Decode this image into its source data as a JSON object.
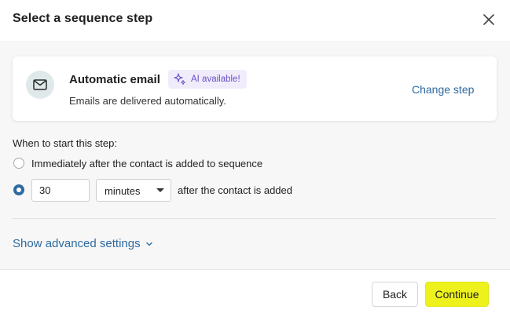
{
  "dialog": {
    "title": "Select a sequence step",
    "close_icon": "close-icon"
  },
  "step": {
    "icon": "mail-icon",
    "name": "Automatic email",
    "ai_badge": {
      "icon": "sparkle-icon",
      "label": "AI available!"
    },
    "description": "Emails are delivered automatically.",
    "change_label": "Change step"
  },
  "timing": {
    "label": "When to start this step:",
    "options": [
      {
        "label": "Immediately after the contact is added to sequence",
        "selected": false
      },
      {
        "selected": true,
        "delay_value": "30",
        "unit": "minutes",
        "suffix": "after the contact is added"
      }
    ]
  },
  "advanced": {
    "label": "Show advanced settings",
    "icon": "chevron-down-icon"
  },
  "footer": {
    "back_label": "Back",
    "continue_label": "Continue"
  },
  "colors": {
    "link": "#2d6aa0",
    "primary_button": "#eef21c",
    "ai_badge_bg": "#f1ecfb",
    "ai_badge_text": "#6b4fc9",
    "radio_selected": "#2d6aa0",
    "body_background": "#f7f7f7"
  }
}
